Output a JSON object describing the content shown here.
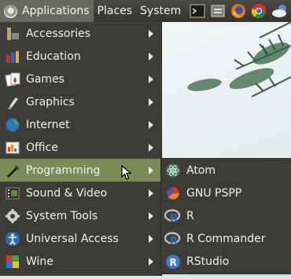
{
  "panel": {
    "menus": [
      {
        "label": "Applications",
        "icon": "distro-logo-icon"
      },
      {
        "label": "Places"
      },
      {
        "label": "System"
      }
    ],
    "launchers": [
      "terminal-icon",
      "file-manager-icon",
      "firefox-icon",
      "chrome-icon",
      "weather-icon"
    ]
  },
  "menu": {
    "items": [
      {
        "label": "Accessories",
        "icon": "accessories-icon"
      },
      {
        "label": "Education",
        "icon": "education-icon"
      },
      {
        "label": "Games",
        "icon": "games-icon"
      },
      {
        "label": "Graphics",
        "icon": "graphics-icon"
      },
      {
        "label": "Internet",
        "icon": "internet-icon"
      },
      {
        "label": "Office",
        "icon": "office-icon"
      },
      {
        "label": "Programming",
        "icon": "programming-icon",
        "highlighted": true
      },
      {
        "label": "Sound & Video",
        "icon": "sound-video-icon"
      },
      {
        "label": "System Tools",
        "icon": "system-tools-icon"
      },
      {
        "label": "Universal Access",
        "icon": "universal-access-icon"
      },
      {
        "label": "Wine",
        "icon": "wine-icon"
      }
    ]
  },
  "submenu": {
    "items": [
      {
        "label": "Atom",
        "icon": "atom-icon"
      },
      {
        "label": "GNU PSPP",
        "icon": "pspp-icon"
      },
      {
        "label": "R",
        "icon": "r-icon"
      },
      {
        "label": "R Commander",
        "icon": "r-icon"
      },
      {
        "label": "RStudio",
        "icon": "rstudio-icon"
      }
    ]
  },
  "colors": {
    "panel": "#3f3e39",
    "menu_bg": "#3d3c38",
    "highlight": "#7d8a55",
    "text": "#f1f1ec"
  }
}
